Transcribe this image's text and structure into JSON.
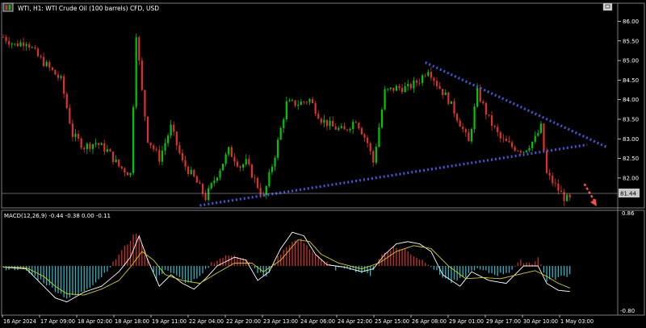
{
  "header": {
    "title": "WTI, H1:  WTI Crude Oil (100 barrels) CFD, USD"
  },
  "macd": {
    "label": "MACD(12,26,9) -0.44 -0.38 0.00 -0.11",
    "axis_top_label": "0.86",
    "axis_bottom_label": "-0.80"
  },
  "price_tag": "81.44",
  "colors": {
    "background": "#000000",
    "bull": "#00c800",
    "bear": "#e0302a",
    "trendline": "#3f57d8",
    "arrow": "#ff4b4b",
    "histogram_pos": "#c8302a",
    "histogram_neg": "#2ab6c4",
    "macd_line": "#ffffff",
    "signal_line": "#d8d000",
    "axis": "#ffffff",
    "grid": "#ffffff"
  },
  "icons": {
    "chart_icon": "candlestick-chart-icon",
    "window_button": "restore-window-icon"
  },
  "chart_data": [
    {
      "type": "candlestick",
      "title": "WTI, H1:  WTI Crude Oil (100 barrels) CFD, USD",
      "y_ticks": [
        "86.00",
        "85.50",
        "85.00",
        "84.50",
        "84.00",
        "83.50",
        "83.00",
        "82.50",
        "82.00"
      ],
      "ylim": [
        81.2,
        86.5
      ],
      "x_ticks": [
        "16 Apr 2024",
        "17 Apr 09:00",
        "18 Apr 02:00",
        "18 Apr 18:00",
        "19 Apr 11:00",
        "22 Apr 04:00",
        "22 Apr 20:00",
        "23 Apr 13:00",
        "24 Apr 06:00",
        "24 Apr 22:00",
        "25 Apr 15:00",
        "26 Apr 08:00",
        "29 Apr 01:00",
        "29 Apr 17:00",
        "30 Apr 10:00",
        "1 May 03:00"
      ],
      "close_path": [
        [
          0,
          85.6
        ],
        [
          4,
          85.4
        ],
        [
          8,
          85.5
        ],
        [
          12,
          85.1
        ],
        [
          16,
          84.8
        ],
        [
          20,
          84.5
        ],
        [
          24,
          83.1
        ],
        [
          28,
          82.8
        ],
        [
          32,
          82.9
        ],
        [
          36,
          82.7
        ],
        [
          40,
          82.3
        ],
        [
          44,
          82.1
        ],
        [
          46,
          85.7
        ],
        [
          48,
          84.2
        ],
        [
          50,
          83.0
        ],
        [
          54,
          82.5
        ],
        [
          58,
          83.3
        ],
        [
          62,
          82.4
        ],
        [
          66,
          82.0
        ],
        [
          70,
          81.5
        ],
        [
          74,
          82.1
        ],
        [
          78,
          82.7
        ],
        [
          82,
          82.3
        ],
        [
          84,
          82.4
        ],
        [
          88,
          81.8
        ],
        [
          90,
          81.5
        ],
        [
          94,
          82.6
        ],
        [
          98,
          83.9
        ],
        [
          102,
          83.9
        ],
        [
          106,
          84.0
        ],
        [
          110,
          83.5
        ],
        [
          114,
          83.3
        ],
        [
          118,
          83.2
        ],
        [
          122,
          83.5
        ],
        [
          126,
          82.9
        ],
        [
          128,
          82.4
        ],
        [
          132,
          84.2
        ],
        [
          136,
          84.3
        ],
        [
          140,
          84.3
        ],
        [
          144,
          84.5
        ],
        [
          147,
          84.8
        ],
        [
          150,
          84.4
        ],
        [
          154,
          84.0
        ],
        [
          158,
          83.4
        ],
        [
          161,
          82.9
        ],
        [
          164,
          84.2
        ],
        [
          168,
          83.5
        ],
        [
          172,
          83.0
        ],
        [
          176,
          82.8
        ],
        [
          180,
          82.7
        ],
        [
          184,
          83.0
        ],
        [
          186,
          83.3
        ],
        [
          188,
          82.1
        ],
        [
          191,
          81.8
        ],
        [
          194,
          81.5
        ],
        [
          196,
          81.44
        ]
      ],
      "trendlines": [
        {
          "name": "",
          "style": "dotted",
          "points": [
            [
              68,
              81.3
            ],
            [
              202,
              82.85
            ]
          ]
        },
        {
          "name": "",
          "style": "dotted",
          "points": [
            [
              146,
              84.95
            ],
            [
              209,
              82.78
            ]
          ]
        }
      ],
      "projection_arrow": {
        "from": [
          201,
          81.85
        ],
        "to": [
          205,
          81.3
        ]
      },
      "current_price": 81.44
    },
    {
      "type": "bar",
      "title": "MACD(12,26,9) -0.44 -0.38 0.00 -0.11",
      "ylim": [
        -0.8,
        0.86
      ],
      "histogram": [
        [
          0,
          -0.05
        ],
        [
          6,
          -0.05
        ],
        [
          10,
          -0.15
        ],
        [
          14,
          -0.28
        ],
        [
          18,
          -0.42
        ],
        [
          22,
          -0.55
        ],
        [
          26,
          -0.5
        ],
        [
          30,
          -0.35
        ],
        [
          34,
          -0.18
        ],
        [
          38,
          0.05
        ],
        [
          40,
          0.2
        ],
        [
          44,
          0.45
        ],
        [
          46,
          0.58
        ],
        [
          48,
          0.4
        ],
        [
          50,
          0.15
        ],
        [
          53,
          -0.25
        ],
        [
          56,
          -0.05
        ],
        [
          60,
          -0.18
        ],
        [
          64,
          -0.3
        ],
        [
          68,
          -0.2
        ],
        [
          72,
          0.05
        ],
        [
          76,
          0.15
        ],
        [
          80,
          0.2
        ],
        [
          84,
          0.1
        ],
        [
          88,
          -0.1
        ],
        [
          91,
          -0.2
        ],
        [
          95,
          0.15
        ],
        [
          99,
          0.38
        ],
        [
          103,
          0.45
        ],
        [
          107,
          0.25
        ],
        [
          111,
          0.08
        ],
        [
          115,
          -0.05
        ],
        [
          119,
          -0.02
        ],
        [
          123,
          -0.1
        ],
        [
          127,
          -0.15
        ],
        [
          131,
          0.2
        ],
        [
          135,
          0.32
        ],
        [
          139,
          0.28
        ],
        [
          143,
          0.15
        ],
        [
          147,
          0.05
        ],
        [
          151,
          -0.15
        ],
        [
          155,
          -0.28
        ],
        [
          159,
          -0.22
        ],
        [
          163,
          -0.05
        ],
        [
          167,
          -0.1
        ],
        [
          171,
          -0.15
        ],
        [
          175,
          -0.1
        ],
        [
          179,
          0.08
        ],
        [
          183,
          0.05
        ],
        [
          185,
          0.15
        ],
        [
          188,
          -0.25
        ],
        [
          192,
          -0.2
        ],
        [
          196,
          -0.15
        ]
      ],
      "macd_line": [
        [
          0,
          -0.02
        ],
        [
          8,
          -0.05
        ],
        [
          14,
          -0.35
        ],
        [
          18,
          -0.55
        ],
        [
          22,
          -0.62
        ],
        [
          28,
          -0.45
        ],
        [
          34,
          -0.35
        ],
        [
          40,
          -0.1
        ],
        [
          44,
          0.15
        ],
        [
          47,
          0.52
        ],
        [
          50,
          0.1
        ],
        [
          54,
          -0.35
        ],
        [
          58,
          -0.15
        ],
        [
          62,
          -0.3
        ],
        [
          66,
          -0.4
        ],
        [
          70,
          -0.22
        ],
        [
          74,
          0.0
        ],
        [
          80,
          0.15
        ],
        [
          84,
          0.1
        ],
        [
          88,
          -0.25
        ],
        [
          92,
          -0.1
        ],
        [
          96,
          0.3
        ],
        [
          100,
          0.58
        ],
        [
          104,
          0.52
        ],
        [
          108,
          0.2
        ],
        [
          112,
          0.02
        ],
        [
          118,
          -0.02
        ],
        [
          124,
          -0.1
        ],
        [
          128,
          -0.05
        ],
        [
          132,
          0.2
        ],
        [
          136,
          0.38
        ],
        [
          140,
          0.42
        ],
        [
          144,
          0.38
        ],
        [
          148,
          0.25
        ],
        [
          152,
          -0.15
        ],
        [
          158,
          -0.35
        ],
        [
          162,
          -0.1
        ],
        [
          168,
          -0.25
        ],
        [
          174,
          -0.3
        ],
        [
          180,
          0.0
        ],
        [
          185,
          0.0
        ],
        [
          188,
          -0.3
        ],
        [
          192,
          -0.42
        ],
        [
          196,
          -0.44
        ]
      ],
      "signal_line": [
        [
          0,
          -0.02
        ],
        [
          8,
          -0.03
        ],
        [
          14,
          -0.18
        ],
        [
          18,
          -0.35
        ],
        [
          22,
          -0.48
        ],
        [
          28,
          -0.5
        ],
        [
          34,
          -0.4
        ],
        [
          40,
          -0.25
        ],
        [
          44,
          -0.02
        ],
        [
          48,
          0.25
        ],
        [
          52,
          0.1
        ],
        [
          56,
          -0.15
        ],
        [
          62,
          -0.25
        ],
        [
          68,
          -0.3
        ],
        [
          74,
          -0.12
        ],
        [
          80,
          0.05
        ],
        [
          86,
          0.05
        ],
        [
          90,
          -0.1
        ],
        [
          96,
          0.1
        ],
        [
          102,
          0.45
        ],
        [
          106,
          0.42
        ],
        [
          110,
          0.2
        ],
        [
          116,
          0.05
        ],
        [
          124,
          -0.05
        ],
        [
          130,
          0.05
        ],
        [
          136,
          0.25
        ],
        [
          142,
          0.35
        ],
        [
          148,
          0.3
        ],
        [
          154,
          0.0
        ],
        [
          160,
          -0.22
        ],
        [
          166,
          -0.2
        ],
        [
          172,
          -0.22
        ],
        [
          178,
          -0.15
        ],
        [
          184,
          -0.08
        ],
        [
          188,
          -0.18
        ],
        [
          192,
          -0.3
        ],
        [
          196,
          -0.38
        ]
      ],
      "axis_labels": [
        "0.86",
        "-0.80"
      ]
    }
  ]
}
